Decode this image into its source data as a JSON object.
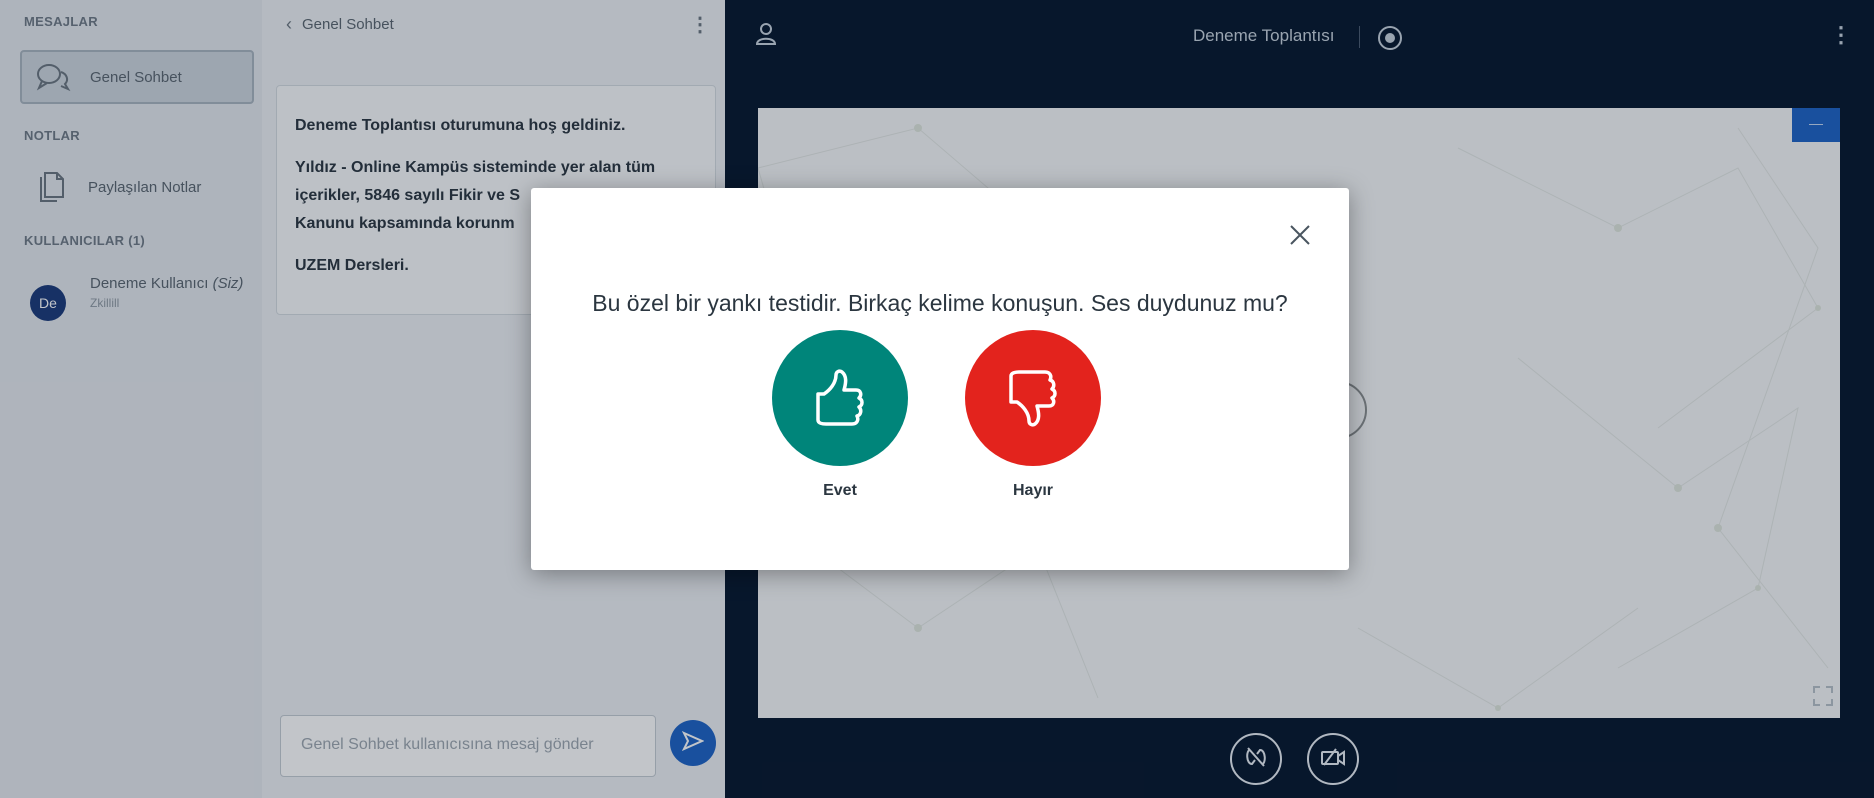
{
  "sidebar": {
    "messages_title": "MESAJLAR",
    "public_chat_label": "Genel Sohbet",
    "notes_title": "NOTLAR",
    "shared_notes_label": "Paylaşılan Notlar",
    "users_title": "KULLANICILAR (1)",
    "user": {
      "initials": "De",
      "name": "Deneme Kullanıcı",
      "you_tag": "(Siz)",
      "status": "Zkillill"
    }
  },
  "chat": {
    "title": "Genel Sohbet",
    "welcome": {
      "line1": "Deneme Toplantısı oturumuna hoş geldiniz.",
      "line2": "Yıldız - Online Kampüs sisteminde yer alan tüm içerikler, 5846 sayılı Fikir ve S",
      "line2_cont": "Kanunu kapsamında korunm",
      "line3": "UZEM Dersleri."
    },
    "input_placeholder": "Genel Sohbet kullanıcısına mesaj gönder"
  },
  "header": {
    "meeting_title": "Deneme Toplantısı"
  },
  "modal": {
    "question": "Bu özel bir yankı testidir. Birkaç kelime konuşun. Ses duydunuz mu?",
    "yes_label": "Evet",
    "no_label": "Hayır"
  },
  "icons": {
    "user": "user-icon",
    "record": "record-icon",
    "kebab": "kebab-menu-icon",
    "chat": "chat-bubbles-icon",
    "notes": "notes-icon",
    "close": "close-icon",
    "thumbs_up": "thumbs-up-icon",
    "thumbs_down": "thumbs-down-icon",
    "audio": "audio-muted-icon",
    "video": "video-off-icon",
    "send": "send-icon",
    "fullscreen": "fullscreen-icon",
    "minimize": "minimize-icon"
  },
  "colors": {
    "main_bg": "#06172e",
    "accent_blue": "#1e63c6",
    "yes_green": "#00857a",
    "no_red": "#e3231d",
    "sidebar_bg": "#e5e9ee",
    "chat_bg": "#eef1f4"
  }
}
